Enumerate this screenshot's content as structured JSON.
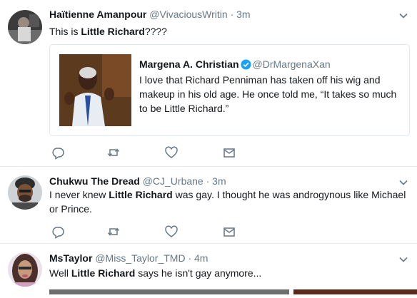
{
  "tweets": [
    {
      "name": "Haïtienne Amanpour",
      "handle": "@VivaciousWritin",
      "sep": "·",
      "time": "3m",
      "text_parts": [
        "This is ",
        "Little Richard",
        "????"
      ],
      "quote": {
        "name": "Margena A. Christian",
        "handle": "@DrMargenaXan",
        "text": "I love that Richard Penniman has taken off his wig and makeup in his old age. He once told me, “It takes so much to be Little Richard.”"
      }
    },
    {
      "name": "Chukwu The Dread",
      "handle": "@CJ_Urbane",
      "sep": "·",
      "time": "3m",
      "text_parts": [
        "I never knew ",
        "Little Richard",
        " was gay. I thought he was androgynous like Michael or Prince."
      ]
    },
    {
      "name": "MsTaylor",
      "handle": "@Miss_Taylor_TMD",
      "sep": "·",
      "time": "4m",
      "text_parts": [
        "Well ",
        "Little Richard",
        " says he isn't gay anymore..."
      ]
    }
  ],
  "icons": {
    "reply": "reply-icon",
    "retweet": "retweet-icon",
    "like": "heart-icon",
    "dm": "envelope-icon",
    "caret": "chevron-down-icon",
    "verified": "verified-badge-icon"
  },
  "colors": {
    "secondary_text": "#657786",
    "icon_gray": "#657786",
    "verified_blue": "#1da1f2",
    "divider": "#e6ecf0"
  }
}
